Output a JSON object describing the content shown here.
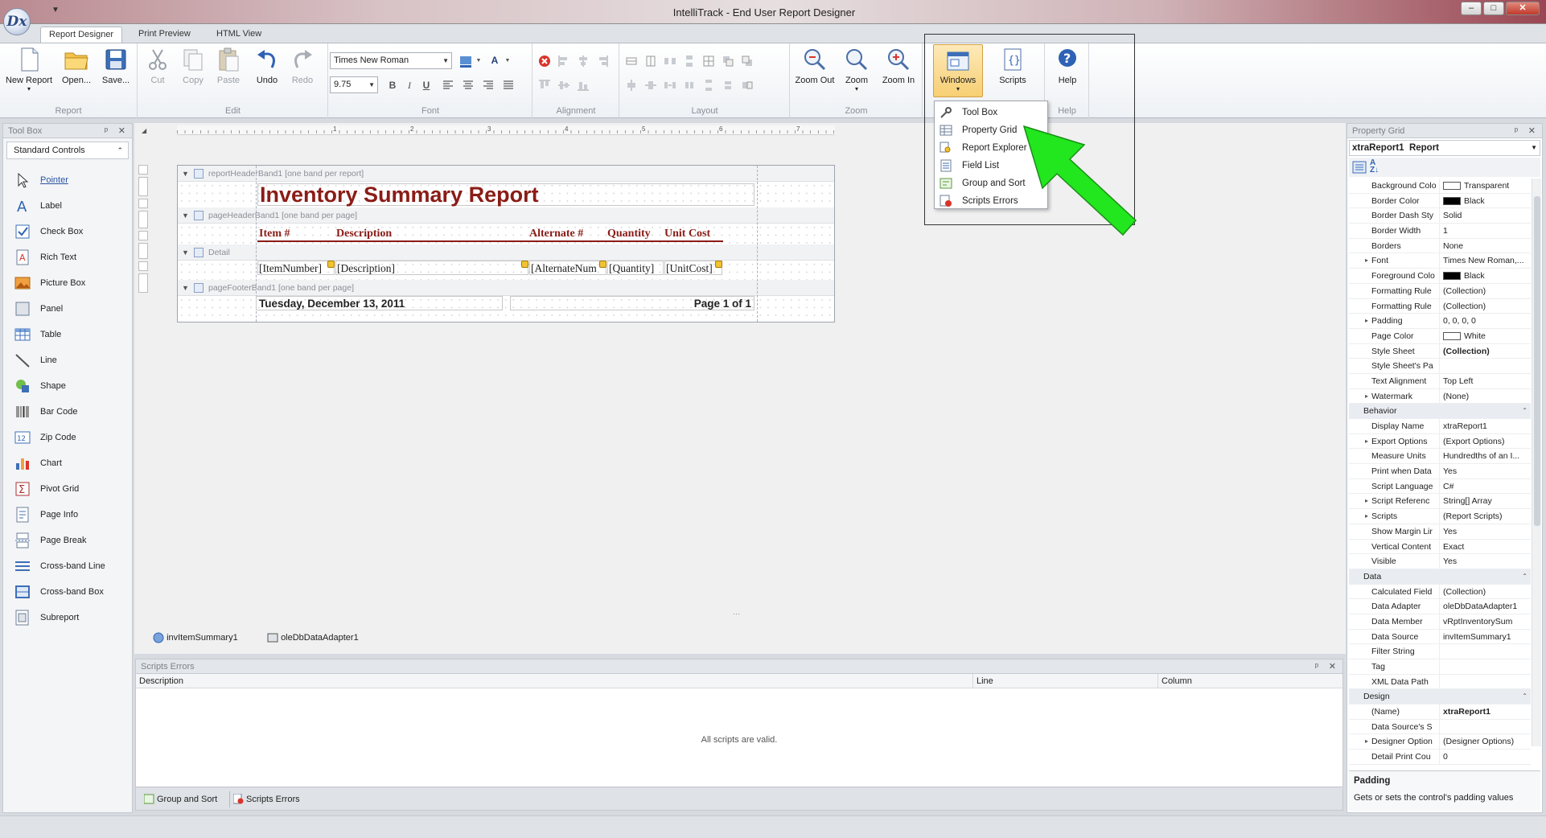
{
  "window": {
    "title": "IntelliTrack - End User Report Designer",
    "qat_glyph": "▼",
    "orb_glyph": "Dx",
    "controls": {
      "minimize": "–",
      "maximize": "□",
      "close": "✕"
    }
  },
  "ribbon_tabs": [
    "Report Designer",
    "Print Preview",
    "HTML View"
  ],
  "ribbon": {
    "groups": {
      "report": "Report",
      "edit": "Edit",
      "font": "Font",
      "alignment": "Alignment",
      "layout": "Layout",
      "zoom": "Zoom",
      "help": "Help"
    },
    "buttons": {
      "new_report": "New Report",
      "open": "Open...",
      "save": "Save...",
      "cut": "Cut",
      "copy": "Copy",
      "paste": "Paste",
      "undo": "Undo",
      "redo": "Redo",
      "zoom_out": "Zoom Out",
      "zoom": "Zoom",
      "zoom_in": "Zoom In",
      "windows": "Windows",
      "scripts": "Scripts",
      "help": "Help"
    },
    "font_name": "Times New Roman",
    "font_size": "9.75",
    "format": {
      "bold": "B",
      "italic": "I",
      "underline": "U",
      "font_color_glyph": "A"
    }
  },
  "windows_menu": [
    "Tool Box",
    "Property Grid",
    "Report Explorer",
    "Field List",
    "Group and Sort",
    "Scripts Errors"
  ],
  "toolbox": {
    "title": "Tool Box",
    "group": "Standard Controls",
    "items": [
      "Pointer",
      "Label",
      "Check Box",
      "Rich Text",
      "Picture Box",
      "Panel",
      "Table",
      "Line",
      "Shape",
      "Bar Code",
      "Zip Code",
      "Chart",
      "Pivot Grid",
      "Page Info",
      "Page Break",
      "Cross-band Line",
      "Cross-band Box",
      "Subreport"
    ]
  },
  "ruler_numbers": [
    "1",
    "2",
    "3",
    "4",
    "5",
    "6",
    "7"
  ],
  "report": {
    "bands": {
      "report_header": "reportHeaderBand1 [one band per report]",
      "page_header": "pageHeaderBand1 [one band per page]",
      "detail": "Detail",
      "page_footer": "pageFooterBand1 [one band per page]"
    },
    "title": "Inventory Summary Report",
    "columns": [
      "Item #",
      "Description",
      "Alternate #",
      "Quantity",
      "Unit Cost"
    ],
    "detail_fields": [
      "[ItemNumber]",
      "[Description]",
      "[AlternateNum",
      "[Quantity]",
      "[UnitCost]"
    ],
    "footer_date": "Tuesday, December 13, 2011",
    "footer_page": "Page 1 of 1"
  },
  "components": [
    "invItemSummary1",
    "oleDbDataAdapter1"
  ],
  "scripts_errors": {
    "title": "Scripts Errors",
    "columns": [
      "Description",
      "Line",
      "Column"
    ],
    "message": "All scripts are valid."
  },
  "bottom_tabs": [
    "Group and Sort",
    "Scripts Errors"
  ],
  "property_grid": {
    "title": "Property Grid",
    "object": "xtraReport1",
    "object_type": "Report",
    "rows": [
      {
        "name": "Background Colo",
        "value": "Transparent",
        "swatch": "#ffffff"
      },
      {
        "name": "Border Color",
        "value": "Black",
        "swatch": "#000000"
      },
      {
        "name": "Border Dash Sty",
        "value": "Solid"
      },
      {
        "name": "Border Width",
        "value": "1"
      },
      {
        "name": "Borders",
        "value": "None"
      },
      {
        "name": "Font",
        "value": "Times New Roman,...",
        "expand": true
      },
      {
        "name": "Foreground Colo",
        "value": "Black",
        "swatch": "#000000"
      },
      {
        "name": "Formatting Rule",
        "value": "(Collection)"
      },
      {
        "name": "Formatting Rule",
        "value": "(Collection)"
      },
      {
        "name": "Padding",
        "value": "0, 0, 0, 0",
        "expand": true
      },
      {
        "name": "Page Color",
        "value": "White",
        "swatch": "#ffffff"
      },
      {
        "name": "Style Sheet",
        "value": "(Collection)",
        "bold": true
      },
      {
        "name": "Style Sheet's Pa",
        "value": ""
      },
      {
        "name": "Text Alignment",
        "value": "Top Left"
      },
      {
        "name": "Watermark",
        "value": "(None)",
        "expand": true
      },
      {
        "category": "Behavior"
      },
      {
        "name": "Display Name",
        "value": "xtraReport1"
      },
      {
        "name": "Export Options",
        "value": "(Export Options)",
        "expand": true
      },
      {
        "name": "Measure Units",
        "value": "Hundredths of an I..."
      },
      {
        "name": "Print when Data",
        "value": "Yes"
      },
      {
        "name": "Script Language",
        "value": "C#"
      },
      {
        "name": "Script Referenc",
        "value": "String[] Array",
        "expand": true
      },
      {
        "name": "Scripts",
        "value": "(Report Scripts)",
        "expand": true
      },
      {
        "name": "Show Margin Lir",
        "value": "Yes"
      },
      {
        "name": "Vertical Content",
        "value": "Exact"
      },
      {
        "name": "Visible",
        "value": "Yes"
      },
      {
        "category": "Data"
      },
      {
        "name": "Calculated Field",
        "value": "(Collection)"
      },
      {
        "name": "Data Adapter",
        "value": "oleDbDataAdapter1"
      },
      {
        "name": "Data Member",
        "value": "vRptInventorySum"
      },
      {
        "name": "Data Source",
        "value": "invItemSummary1"
      },
      {
        "name": "Filter String",
        "value": ""
      },
      {
        "name": "Tag",
        "value": ""
      },
      {
        "name": "XML Data Path",
        "value": ""
      },
      {
        "category": "Design"
      },
      {
        "name": "(Name)",
        "value": "xtraReport1",
        "bold": true
      },
      {
        "name": "Data Source's S",
        "value": ""
      },
      {
        "name": "Designer Option",
        "value": "(Designer Options)",
        "expand": true
      },
      {
        "name": "Detail Print Cou",
        "value": "0"
      }
    ],
    "description_title": "Padding",
    "description_text": "Gets or sets the control's padding values"
  },
  "colors": {
    "report_title": "#8a1c16",
    "arrow": "#22e61e",
    "highlight": "#f7cf73"
  }
}
